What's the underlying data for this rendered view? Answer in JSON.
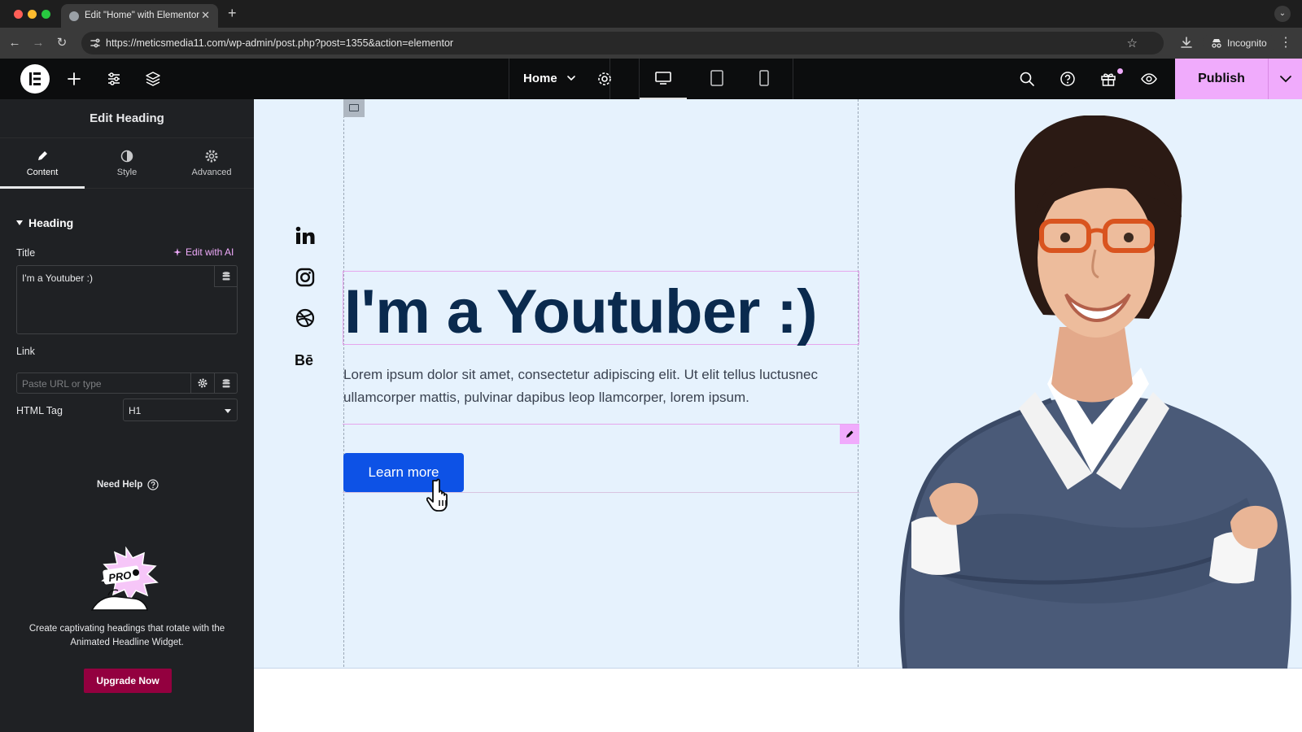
{
  "browser": {
    "tab_title": "Edit \"Home\" with Elementor",
    "url": "https://meticsmedia11.com/wp-admin/post.php?post=1355&action=elementor",
    "incognito_label": "Incognito"
  },
  "topbar": {
    "page_name": "Home",
    "publish_label": "Publish"
  },
  "panel": {
    "title": "Edit Heading",
    "tabs": [
      {
        "label": "Content"
      },
      {
        "label": "Style"
      },
      {
        "label": "Advanced"
      }
    ],
    "section_title": "Heading",
    "title_label": "Title",
    "edit_ai_label": "Edit with AI",
    "title_value": "I'm a Youtuber :)",
    "link_label": "Link",
    "link_placeholder": "Paste URL or type",
    "html_tag_label": "HTML Tag",
    "html_tag_value": "H1",
    "need_help": "Need Help",
    "promo_text": "Create captivating headings that rotate with the Animated Headline Widget.",
    "upgrade_label": "Upgrade Now"
  },
  "canvas": {
    "heading": "I'm a Youtuber :)",
    "paragraph": "Lorem ipsum dolor sit amet, consectetur adipiscing elit. Ut elit tellus luctusnec ullamcorper mattis, pulvinar dapibus leop llamcorper, lorem ipsum.",
    "button_label": "Learn more",
    "social_icons": [
      "linkedin-icon",
      "instagram-icon",
      "dribbble-icon",
      "behance-icon"
    ]
  },
  "colors": {
    "accent": "#f0abfc",
    "upgrade": "#93003f",
    "hero_bg": "#e6f2fd",
    "heading": "#0a2a4e",
    "button": "#0d52e6"
  }
}
